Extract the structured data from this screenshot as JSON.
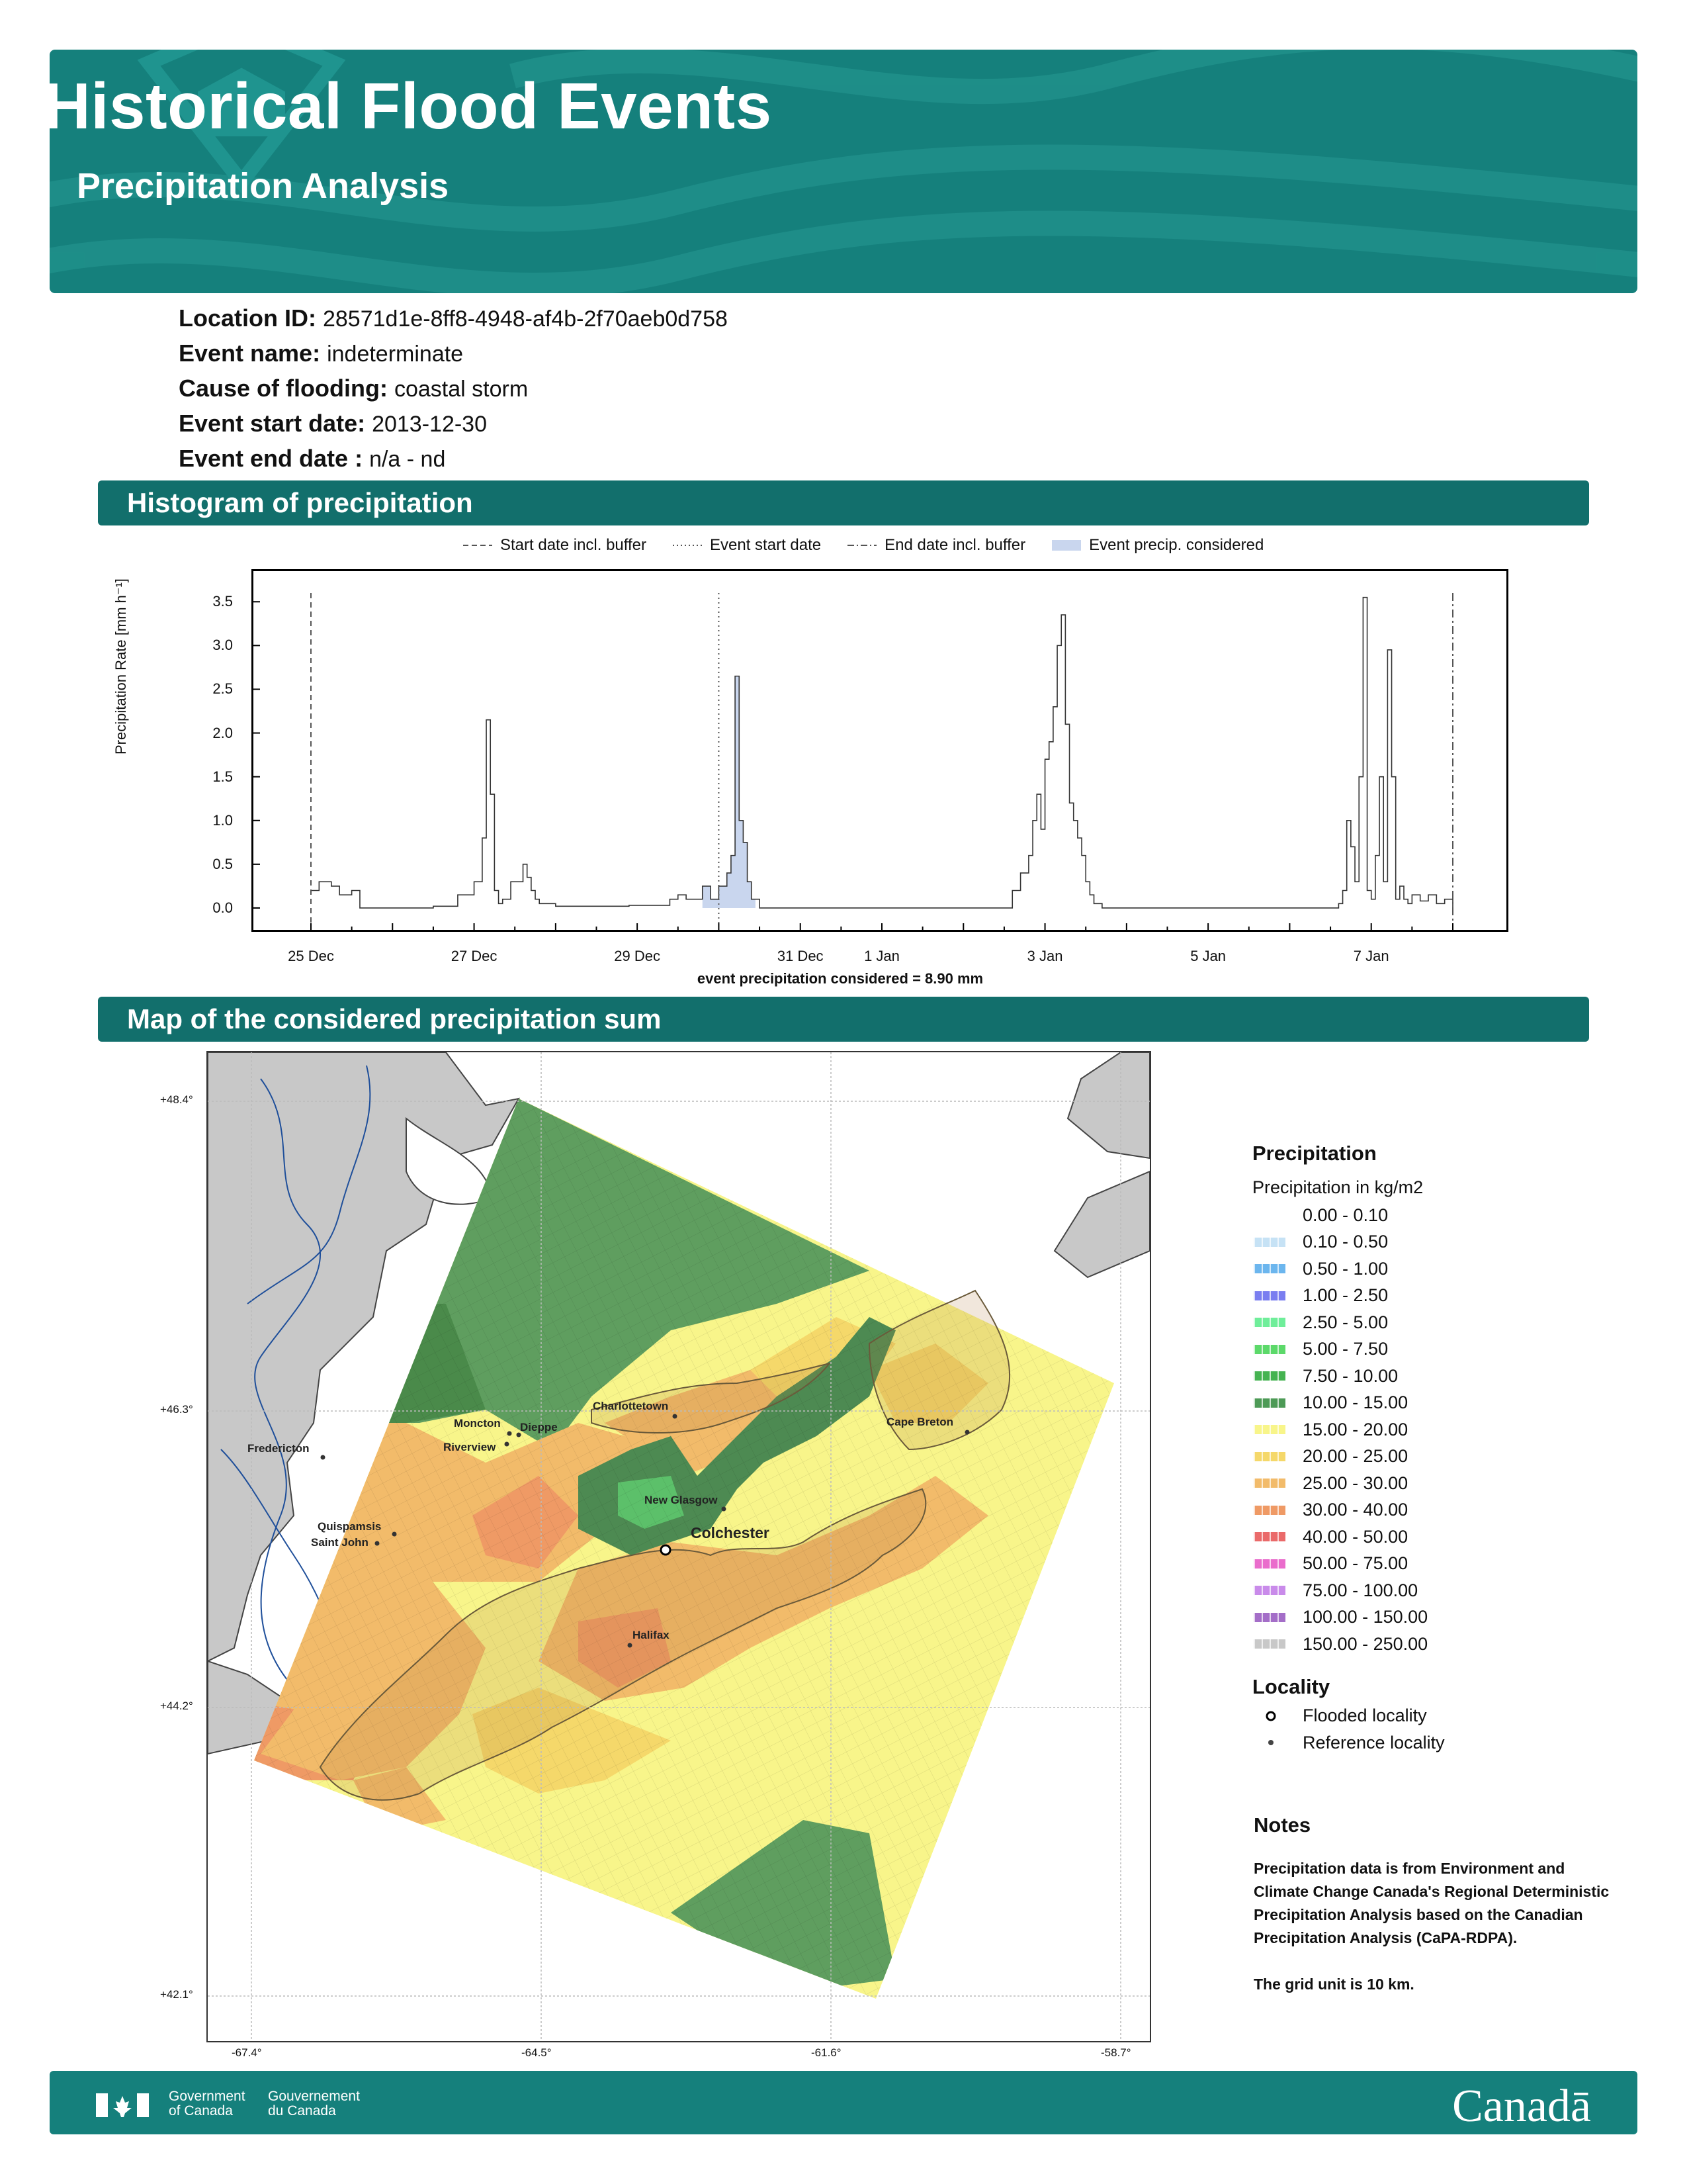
{
  "header": {
    "title": "Historical Flood Events",
    "subtitle": "Precipitation Analysis"
  },
  "event": {
    "location_id_label": "Location ID:",
    "location_id": "28571d1e-8ff8-4948-af4b-2f70aeb0d758",
    "event_name_label": "Event name:",
    "event_name": "indeterminate",
    "cause_label": "Cause of flooding:",
    "cause": "coastal storm",
    "start_label": "Event start date:",
    "start": "2013-12-30",
    "end_label": "Event end date :",
    "end": "n/a - nd"
  },
  "sections": {
    "histogram": "Histogram of precipitation",
    "map": "Map of the considered precipitation sum"
  },
  "chart_data": {
    "type": "line",
    "ylabel": "Precipitation Rate [mm h⁻¹]",
    "xlabel": "",
    "ylim": [
      -0.25,
      3.85
    ],
    "yticks": [
      "0.0",
      "0.5",
      "1.0",
      "1.5",
      "2.0",
      "2.5",
      "3.0",
      "3.5"
    ],
    "xticks": [
      {
        "label": "25 Dec",
        "day": 0
      },
      {
        "label": "27 Dec",
        "day": 2
      },
      {
        "label": "29 Dec",
        "day": 4
      },
      {
        "label": "31 Dec",
        "day": 6
      },
      {
        "label": "1 Jan",
        "day": 7
      },
      {
        "label": "3 Jan",
        "day": 9
      },
      {
        "label": "5 Jan",
        "day": 11
      },
      {
        "label": "7 Jan",
        "day": 13
      }
    ],
    "legend": [
      {
        "label": "Start date incl. buffer",
        "style": "dashed"
      },
      {
        "label": "Event start date",
        "style": "dotted"
      },
      {
        "label": "End date incl. buffer",
        "style": "dashdot"
      },
      {
        "label": "Event precip. considered",
        "style": "fill"
      }
    ],
    "vlines": {
      "start_buffer": 0,
      "event_start": 5,
      "end_buffer": 14
    },
    "series": [
      {
        "x": [
          0,
          0.1,
          0.25,
          0.35,
          0.5,
          0.6,
          0.8,
          1.0,
          1.5,
          1.8,
          2.0,
          2.1,
          2.15,
          2.2,
          2.25,
          2.3,
          2.35,
          2.45,
          2.6,
          2.65,
          2.7,
          2.75,
          2.8,
          2.9,
          3.0,
          3.5,
          3.9,
          4.4,
          4.5,
          4.6,
          4.8,
          4.9,
          5.0,
          5.1,
          5.15,
          5.2,
          5.25,
          5.3,
          5.35,
          5.4,
          5.5,
          5.6,
          6.0,
          7.0,
          8.0,
          8.6,
          8.7,
          8.8,
          8.85,
          8.9,
          8.95,
          9.0,
          9.05,
          9.1,
          9.15,
          9.2,
          9.25,
          9.3,
          9.35,
          9.4,
          9.45,
          9.5,
          9.55,
          9.6,
          9.7,
          9.8,
          10.0,
          11.0,
          12.0,
          12.6,
          12.65,
          12.7,
          12.75,
          12.8,
          12.85,
          12.9,
          12.95,
          13.0,
          13.05,
          13.1,
          13.15,
          13.2,
          13.25,
          13.3,
          13.35,
          13.4,
          13.45,
          13.5,
          13.6,
          13.7,
          13.8,
          13.9,
          14.0
        ],
        "y": [
          0.2,
          0.3,
          0.25,
          0.15,
          0.2,
          0.0,
          0.0,
          0.0,
          0.02,
          0.15,
          0.3,
          0.8,
          2.15,
          1.3,
          0.2,
          0.05,
          0.1,
          0.3,
          0.5,
          0.35,
          0.2,
          0.1,
          0.05,
          0.05,
          0.02,
          0.02,
          0.03,
          0.1,
          0.15,
          0.1,
          0.25,
          0.1,
          0.25,
          0.4,
          0.6,
          2.65,
          1.0,
          0.75,
          0.3,
          0.1,
          0.0,
          0.0,
          0.0,
          0.0,
          0.0,
          0.2,
          0.4,
          0.6,
          1.0,
          1.3,
          0.9,
          1.7,
          1.9,
          2.3,
          3.0,
          3.35,
          2.1,
          1.2,
          1.0,
          0.8,
          0.6,
          0.3,
          0.15,
          0.05,
          0.0,
          0.0,
          0.0,
          0.0,
          0.0,
          0.05,
          0.2,
          1.0,
          0.7,
          0.3,
          1.5,
          3.55,
          0.2,
          0.1,
          0.6,
          1.5,
          0.3,
          2.95,
          1.5,
          0.1,
          0.25,
          0.1,
          0.05,
          0.15,
          0.08,
          0.15,
          0.05,
          0.1,
          0.0
        ]
      }
    ],
    "event_fill": {
      "from": 4.8,
      "to": 5.45
    },
    "summary": "event precipitation considered = 8.90 mm"
  },
  "map": {
    "lat_labels": [
      "+48.4°",
      "+46.3°",
      "+44.2°",
      "+42.1°"
    ],
    "lon_labels": [
      "-67.4°",
      "-64.5°",
      "-61.6°",
      "-58.7°"
    ],
    "towns": {
      "fredericton": "Fredericton",
      "moncton": "Moncton",
      "dieppe": "Dieppe",
      "riverview": "Riverview",
      "charlottetown": "Charlottetown",
      "cape_breton": "Cape Breton",
      "new_glasgow": "New Glasgow",
      "colchester": "Colchester",
      "quispamsis": "Quispamsis",
      "saint_john": "Saint John",
      "halifax": "Halifax"
    }
  },
  "legend": {
    "title": "Precipitation",
    "subtitle": "Precipitation in kg/m2",
    "classes": [
      {
        "label": "0.00 - 0.10",
        "color": "#ffffff"
      },
      {
        "label": "0.10 - 0.50",
        "color": "#c6e2f5"
      },
      {
        "label": "0.50 - 1.00",
        "color": "#6cb6ee"
      },
      {
        "label": "1.00 - 2.50",
        "color": "#7a7ef0"
      },
      {
        "label": "2.50 - 5.00",
        "color": "#6fee9a"
      },
      {
        "label": "5.00 - 7.50",
        "color": "#5cd96a"
      },
      {
        "label": "7.50 - 10.00",
        "color": "#45b351"
      },
      {
        "label": "10.00 - 15.00",
        "color": "#4d9a56"
      },
      {
        "label": "15.00 - 20.00",
        "color": "#f8f58a"
      },
      {
        "label": "20.00 - 25.00",
        "color": "#f5d86a"
      },
      {
        "label": "25.00 - 30.00",
        "color": "#f2bb6a"
      },
      {
        "label": "30.00 - 40.00",
        "color": "#ef9a65"
      },
      {
        "label": "40.00 - 50.00",
        "color": "#ea6a6a"
      },
      {
        "label": "50.00 - 75.00",
        "color": "#ea6ccc"
      },
      {
        "label": "75.00 - 100.00",
        "color": "#c98bea"
      },
      {
        "label": "100.00 - 150.00",
        "color": "#a46ec8"
      },
      {
        "label": "150.00 - 250.00",
        "color": "#c8c8c8"
      }
    ],
    "locality_title": "Locality",
    "flooded": "Flooded locality",
    "reference": "Reference locality"
  },
  "notes": {
    "title": "Notes",
    "text": "Precipitation data is from Environment and Climate Change Canada's Regional Deterministic Precipitation Analysis based on the Canadian Precipitation Analysis (CaPA-RDPA).",
    "grid": "The grid unit is 10 km."
  },
  "footer": {
    "gov_en_1": "Government",
    "gov_en_2": "of Canada",
    "gov_fr_1": "Gouvernement",
    "gov_fr_2": "du Canada",
    "wordmark": "Canadā"
  },
  "colors": {
    "banner": "#15807c",
    "section_bar": "#126f6c",
    "event_fill": "#c9d6ee"
  }
}
